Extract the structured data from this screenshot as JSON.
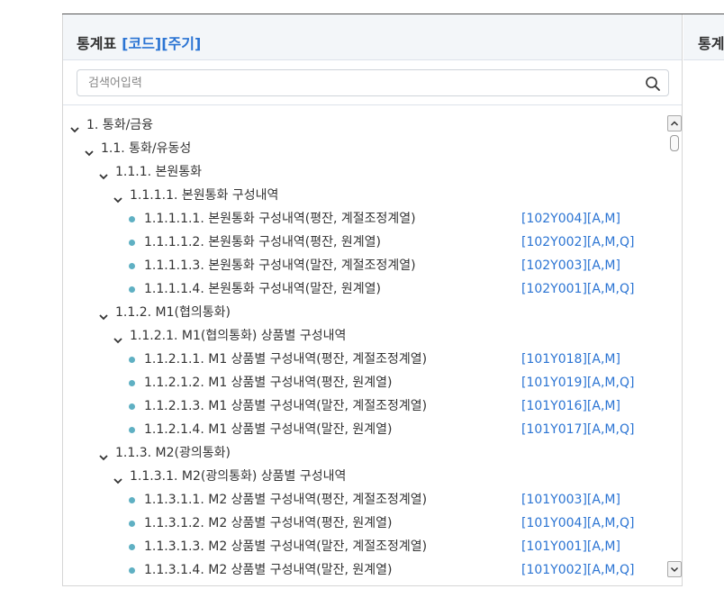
{
  "panel": {
    "title": "통계표",
    "title_codes": "[코드][주기]"
  },
  "right_panel": {
    "title": "통계"
  },
  "search": {
    "placeholder": "검색어입력",
    "value": ""
  },
  "colors": {
    "accent": "#2b74d3",
    "bullet": "#5fb0c3"
  },
  "icons": {
    "search": "search-icon",
    "expand": "chevron-down-icon",
    "leaf": "bullet-dot-icon"
  },
  "tree": [
    {
      "level": 0,
      "type": "folder",
      "label": "1. 통화/금융",
      "code": ""
    },
    {
      "level": 1,
      "type": "folder",
      "label": "1.1. 통화/유동성",
      "code": ""
    },
    {
      "level": 2,
      "type": "folder",
      "label": "1.1.1. 본원통화",
      "code": ""
    },
    {
      "level": 3,
      "type": "folder",
      "label": "1.1.1.1. 본원통화 구성내역",
      "code": ""
    },
    {
      "level": 4,
      "type": "leaf",
      "label": "1.1.1.1.1. 본원통화 구성내역(평잔, 계절조정계열)",
      "code": "[102Y004][A,M]"
    },
    {
      "level": 4,
      "type": "leaf",
      "label": "1.1.1.1.2. 본원통화 구성내역(평잔, 원계열)",
      "code": "[102Y002][A,M,Q]"
    },
    {
      "level": 4,
      "type": "leaf",
      "label": "1.1.1.1.3. 본원통화 구성내역(말잔, 계절조정계열)",
      "code": "[102Y003][A,M]"
    },
    {
      "level": 4,
      "type": "leaf",
      "label": "1.1.1.1.4. 본원통화 구성내역(말잔, 원계열)",
      "code": "[102Y001][A,M,Q]"
    },
    {
      "level": 2,
      "type": "folder",
      "label": "1.1.2. M1(협의통화)",
      "code": ""
    },
    {
      "level": 3,
      "type": "folder",
      "label": "1.1.2.1. M1(협의통화) 상품별 구성내역",
      "code": ""
    },
    {
      "level": 4,
      "type": "leaf",
      "label": "1.1.2.1.1. M1 상품별 구성내역(평잔, 계절조정계열)",
      "code": "[101Y018][A,M]"
    },
    {
      "level": 4,
      "type": "leaf",
      "label": "1.1.2.1.2. M1 상품별 구성내역(평잔, 원계열)",
      "code": "[101Y019][A,M,Q]"
    },
    {
      "level": 4,
      "type": "leaf",
      "label": "1.1.2.1.3. M1 상품별 구성내역(말잔, 계절조정계열)",
      "code": "[101Y016][A,M]"
    },
    {
      "level": 4,
      "type": "leaf",
      "label": "1.1.2.1.4. M1 상품별 구성내역(말잔, 원계열)",
      "code": "[101Y017][A,M,Q]"
    },
    {
      "level": 2,
      "type": "folder",
      "label": "1.1.3. M2(광의통화)",
      "code": ""
    },
    {
      "level": 3,
      "type": "folder",
      "label": "1.1.3.1. M2(광의통화) 상품별 구성내역",
      "code": ""
    },
    {
      "level": 4,
      "type": "leaf",
      "label": "1.1.3.1.1. M2 상품별 구성내역(평잔, 계절조정계열)",
      "code": "[101Y003][A,M]"
    },
    {
      "level": 4,
      "type": "leaf",
      "label": "1.1.3.1.2. M2 상품별 구성내역(평잔, 원계열)",
      "code": "[101Y004][A,M,Q]"
    },
    {
      "level": 4,
      "type": "leaf",
      "label": "1.1.3.1.3. M2 상품별 구성내역(말잔, 계절조정계열)",
      "code": "[101Y001][A,M]"
    },
    {
      "level": 4,
      "type": "leaf",
      "label": "1.1.3.1.4. M2 상품별 구성내역(말잔, 원계열)",
      "code": "[101Y002][A,M,Q]"
    }
  ]
}
